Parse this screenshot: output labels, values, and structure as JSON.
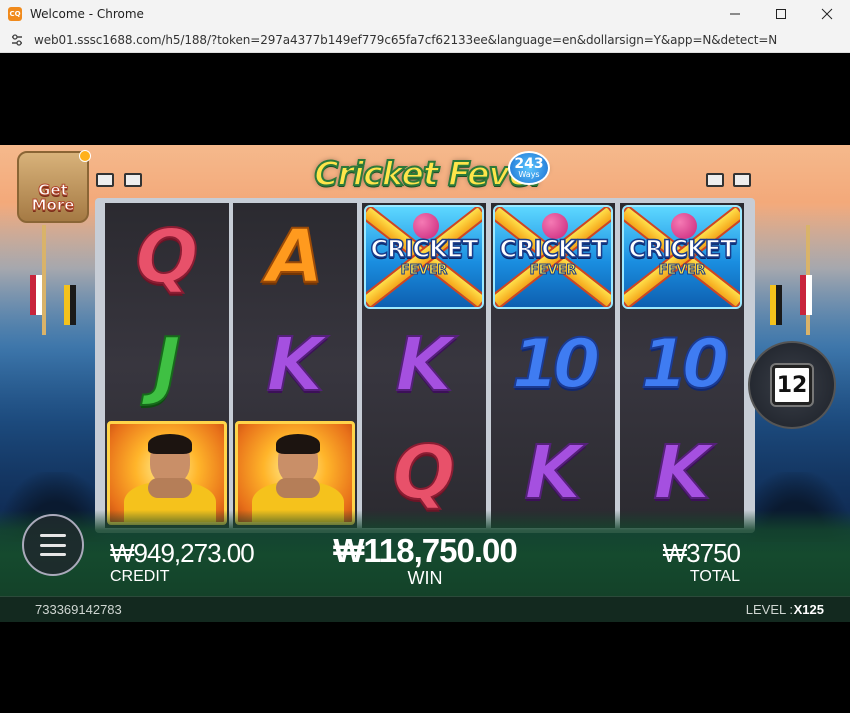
{
  "window": {
    "title": "Welcome - Chrome",
    "app_icon_text": "CQ",
    "minimize_icon": "minimize-icon",
    "maximize_icon": "maximize-icon",
    "close_icon": "close-icon"
  },
  "address_bar": {
    "url": "web01.sssc1688.com/h5/188/?token=297a4377b149ef779c65fa7cf62133ee&language=en&dollarsign=Y&app=N&detect=N"
  },
  "game": {
    "logo": {
      "title": "Cricket Fever",
      "ways_number": "243",
      "ways_label": "Ways"
    },
    "get_more": {
      "line1": "Get",
      "line2": "More"
    },
    "reels": [
      [
        "Q",
        "J",
        "HERO"
      ],
      [
        "A",
        "K",
        "HERO"
      ],
      [
        "WILD",
        "K",
        "Q"
      ],
      [
        "WILD",
        "10",
        "K"
      ],
      [
        "WILD",
        "10",
        "K"
      ]
    ],
    "wild_symbol": {
      "line1": "CRICKET",
      "line2": "FEVER"
    },
    "spin_count": "12",
    "credit": {
      "value": "₩949,273.00",
      "label": "CREDIT"
    },
    "win": {
      "value": "₩118,750.00",
      "label": "WIN"
    },
    "total": {
      "value": "₩3750",
      "label": "TOTAL"
    },
    "session_id": "733369142783",
    "level": {
      "label": "LEVEL :",
      "value": "X125"
    }
  }
}
